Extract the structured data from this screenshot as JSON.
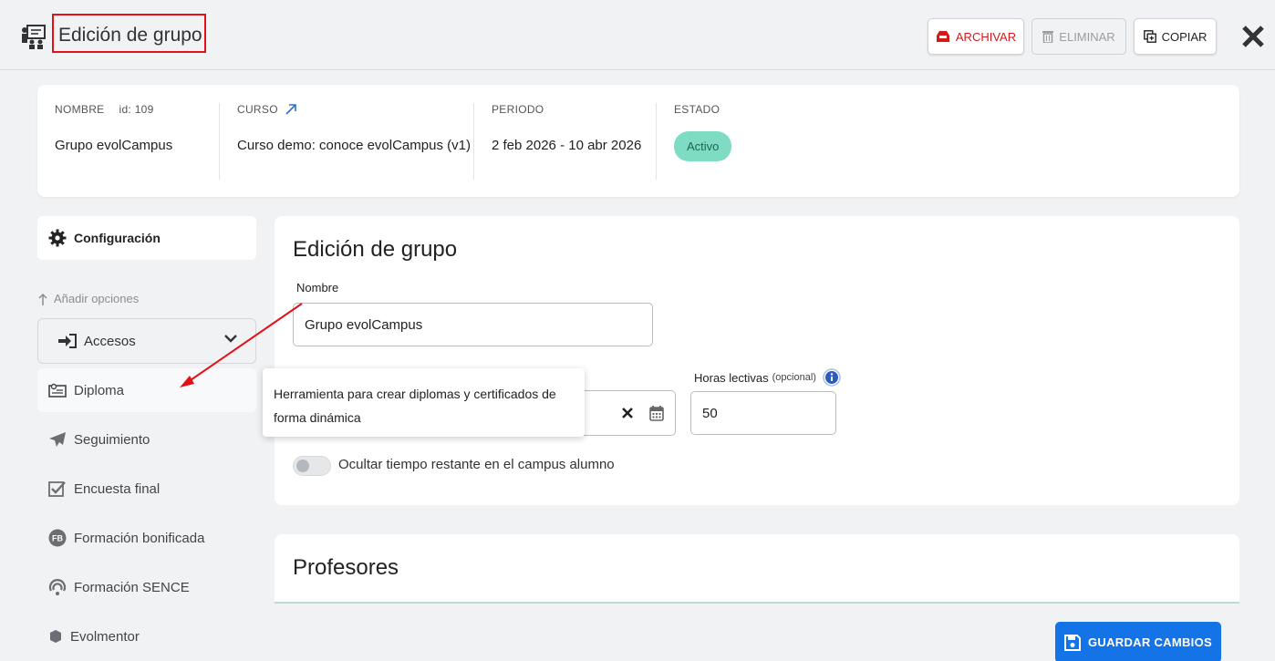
{
  "header": {
    "title": "Edición de grupo",
    "archive_label": "ARCHIVAR",
    "delete_label": "ELIMINAR",
    "copy_label": "COPIAR",
    "icons": [
      "group-edit-icon",
      "archive-icon",
      "trash-icon",
      "copy-icon",
      "close-icon"
    ]
  },
  "summary": {
    "nombre_label": "NOMBRE",
    "id_text": "id: 109",
    "nombre_value": "Grupo evolCampus",
    "curso_label": "CURSO",
    "curso_value": "Curso demo: conoce evolCampus (v1)",
    "periodo_label": "PERIODO",
    "periodo_value": "2 feb 2026 - 10 abr 2026",
    "estado_label": "ESTADO",
    "estado_value": "Activo",
    "estado_color": "#7fdcc4"
  },
  "sidebar": {
    "config_label": "Configuración",
    "add_options_label": "Añadir opciones",
    "accesos_label": "Accesos",
    "items": [
      {
        "label": "Diploma",
        "icon": "diploma-icon"
      },
      {
        "label": "Seguimiento",
        "icon": "paper-plane-icon"
      },
      {
        "label": "Encuesta final",
        "icon": "checkbox-icon"
      },
      {
        "label": "Formación bonificada",
        "icon": "fb-icon"
      },
      {
        "label": "Formación SENCE",
        "icon": "sence-icon"
      },
      {
        "label": "Evolmentor",
        "icon": "evolmentor-icon"
      }
    ]
  },
  "form": {
    "title": "Edición de grupo",
    "nombre_label": "Nombre",
    "nombre_value": "Grupo evolCampus",
    "horas_label": "Horas lectivas",
    "horas_optional": "(opcional)",
    "horas_value": "50",
    "toggle_label": "Ocultar tiempo restante en el campus alumno",
    "toggle_on": false
  },
  "tooltip": {
    "text": "Herramienta para crear diplomas y certificados de forma dinámica"
  },
  "profesores": {
    "title": "Profesores"
  },
  "save": {
    "label": "GUARDAR CAMBIOS",
    "color": "#1473e6"
  },
  "colors": {
    "accent_red": "#e3101a",
    "archive_red": "#d11b1b"
  }
}
